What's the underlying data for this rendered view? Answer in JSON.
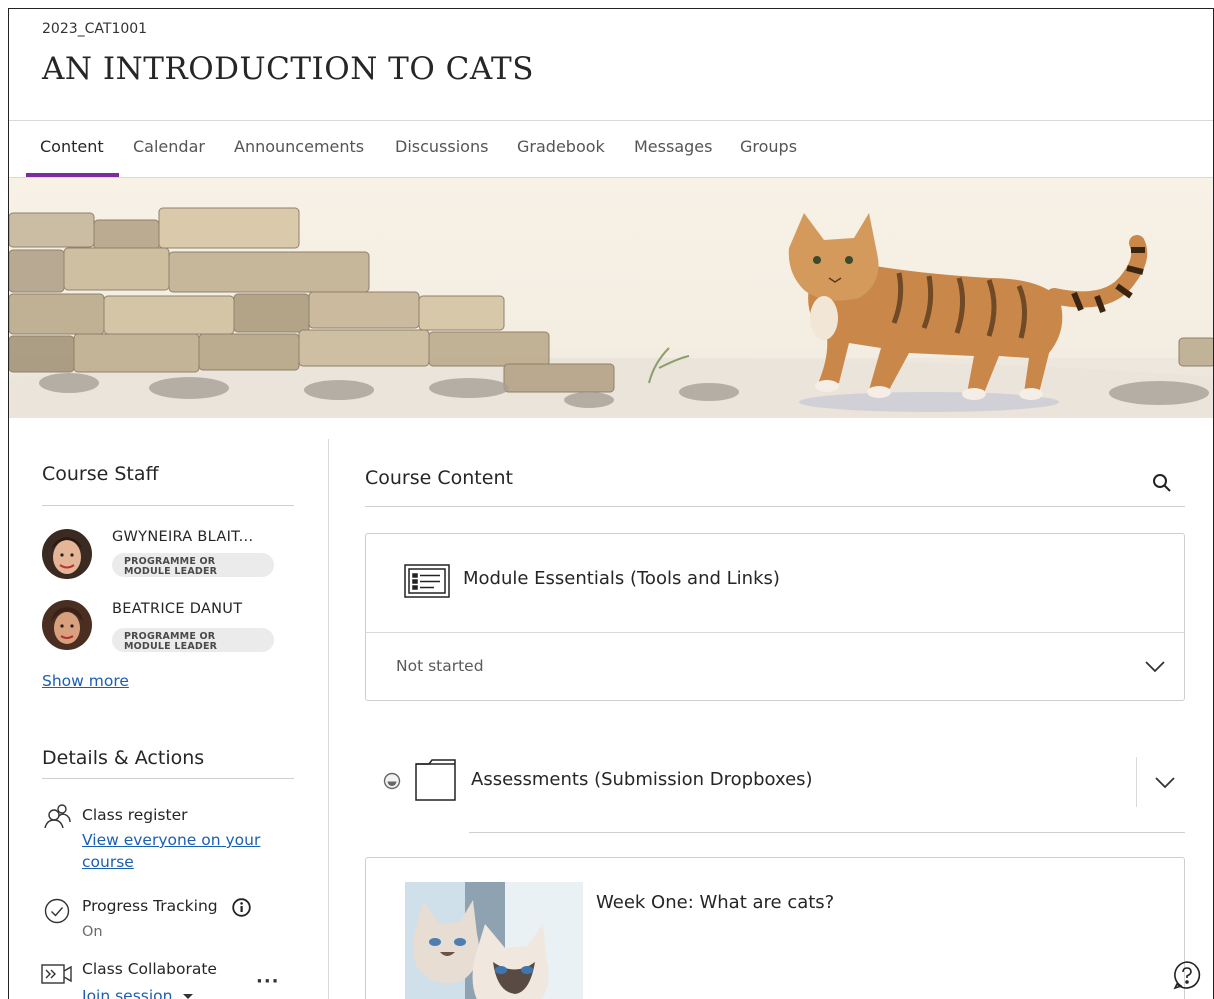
{
  "header": {
    "course_code": "2023_CAT1001",
    "course_title": "AN INTRODUCTION TO CATS"
  },
  "tabs": [
    {
      "label": "Content",
      "active": true
    },
    {
      "label": "Calendar",
      "active": false
    },
    {
      "label": "Announcements",
      "active": false
    },
    {
      "label": "Discussions",
      "active": false
    },
    {
      "label": "Gradebook",
      "active": false
    },
    {
      "label": "Messages",
      "active": false
    },
    {
      "label": "Groups",
      "active": false
    }
  ],
  "colors": {
    "accent": "#7a2d9c",
    "link": "#1a5fb4"
  },
  "sidebar": {
    "course_staff_heading": "Course Staff",
    "staff": [
      {
        "name": "GWYNEIRA BLAIT...",
        "role_line1": "PROGRAMME OR",
        "role_line2": "MODULE LEADER"
      },
      {
        "name": "BEATRICE DANUT",
        "role_line1": "PROGRAMME OR",
        "role_line2": "MODULE LEADER"
      }
    ],
    "show_more": "Show more",
    "details_heading": "Details & Actions",
    "class_register": {
      "label": "Class register",
      "link_line1": "View everyone on your",
      "link_line2": "course"
    },
    "progress_tracking": {
      "label": "Progress Tracking",
      "status": "On"
    },
    "class_collaborate": {
      "label": "Class Collaborate",
      "link": "Join session"
    }
  },
  "main": {
    "title": "Course Content",
    "items": [
      {
        "title": "Module Essentials (Tools and Links)",
        "status": "Not started",
        "icon": "list-icon"
      },
      {
        "title": "Assessments (Submission Dropboxes)",
        "icon": "folder-icon"
      },
      {
        "title": "Week One: What are cats?",
        "icon": "cats-thumbnail"
      }
    ]
  }
}
